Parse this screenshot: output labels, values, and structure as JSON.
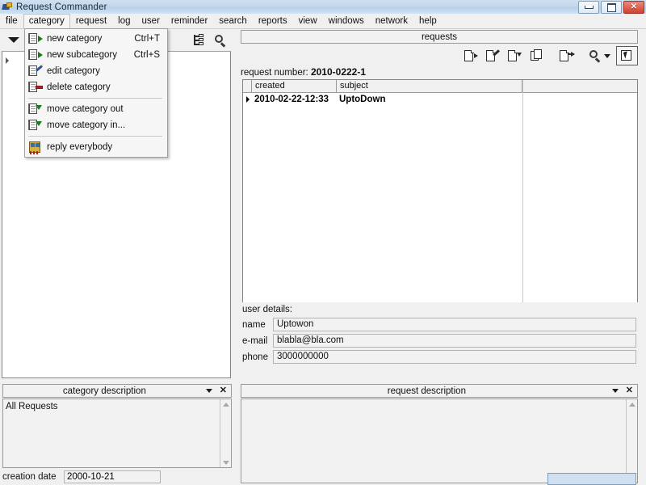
{
  "window": {
    "title": "Request Commander",
    "icon": "app-icon",
    "buttons": {
      "minimize": "minimize",
      "maximize": "maximize",
      "close": "close"
    }
  },
  "menubar": {
    "items": [
      {
        "label": "file",
        "active": false
      },
      {
        "label": "category",
        "active": true
      },
      {
        "label": "request",
        "active": false
      },
      {
        "label": "log",
        "active": false
      },
      {
        "label": "user",
        "active": false
      },
      {
        "label": "reminder",
        "active": false
      },
      {
        "label": "search",
        "active": false
      },
      {
        "label": "reports",
        "active": false
      },
      {
        "label": "view",
        "active": false
      },
      {
        "label": "windows",
        "active": false
      },
      {
        "label": "network",
        "active": false
      },
      {
        "label": "help",
        "active": false
      }
    ]
  },
  "dropdown": {
    "open_for": "category",
    "items": [
      {
        "type": "item",
        "icon": "new-category-icon",
        "label": "new category",
        "accel": "Ctrl+T"
      },
      {
        "type": "item",
        "icon": "new-subcategory-icon",
        "label": "new subcategory",
        "accel": "Ctrl+S"
      },
      {
        "type": "item",
        "icon": "edit-category-icon",
        "label": "edit category",
        "accel": ""
      },
      {
        "type": "item",
        "icon": "delete-category-icon",
        "label": "delete category",
        "accel": ""
      },
      {
        "type": "separator"
      },
      {
        "type": "item",
        "icon": "move-category-out-icon",
        "label": "move category out",
        "accel": ""
      },
      {
        "type": "item",
        "icon": "move-category-in-icon",
        "label": "move category in...",
        "accel": ""
      },
      {
        "type": "separator"
      },
      {
        "type": "item",
        "icon": "reply-everybody-icon",
        "label": "reply everybody",
        "accel": ""
      }
    ]
  },
  "left_pane": {
    "toolbar": [
      {
        "icon": "dropdown-caret-icon"
      },
      {
        "icon": "small-caret-icon"
      },
      {
        "icon": "tree-structure-icon"
      },
      {
        "icon": "search-icon"
      }
    ]
  },
  "requests_panel": {
    "caption": "requests",
    "toolbar": [
      {
        "icon": "new-request-icon"
      },
      {
        "icon": "edit-request-icon"
      },
      {
        "icon": "save-request-icon"
      },
      {
        "icon": "copy-request-icon"
      },
      {
        "icon": "close-request-icon"
      },
      {
        "icon": "search-icon"
      },
      {
        "icon": "search-dropdown-caret-icon"
      },
      {
        "icon": "select-request-icon"
      }
    ],
    "request_number_label": "request number:",
    "request_number_value": "2010-0222-1",
    "grid": {
      "columns": [
        "created",
        "subject"
      ],
      "rows": [
        {
          "indicator": "▶",
          "created": "2010-02-22-12:33",
          "subject": "UptoDown"
        }
      ]
    }
  },
  "user_details": {
    "title": "user details:",
    "fields": [
      {
        "label": "name",
        "value": "Uptowon"
      },
      {
        "label": "e-mail",
        "value": "blabla@bla.com"
      },
      {
        "label": "phone",
        "value": "3000000000"
      }
    ]
  },
  "category_description": {
    "caption": "category description",
    "body": "All Requests",
    "creation_date_label": "creation date",
    "creation_date_value": "2000-10-21",
    "collapse_icon": "chevron-down-icon",
    "close_icon": "close-icon"
  },
  "request_description": {
    "caption": "request description",
    "body": "",
    "collapse_icon": "chevron-down-icon",
    "close_icon": "close-icon"
  },
  "colors": {
    "titlebar": "#c3d7ec",
    "close_button": "#cf4030",
    "panel_bg": "#f0f0f0",
    "field_bg": "#f2f2f2",
    "border": "#9a9a9a",
    "icon_green": "#1b7a1b",
    "icon_red": "#b02020",
    "icon_blue": "#3b6ea5"
  }
}
